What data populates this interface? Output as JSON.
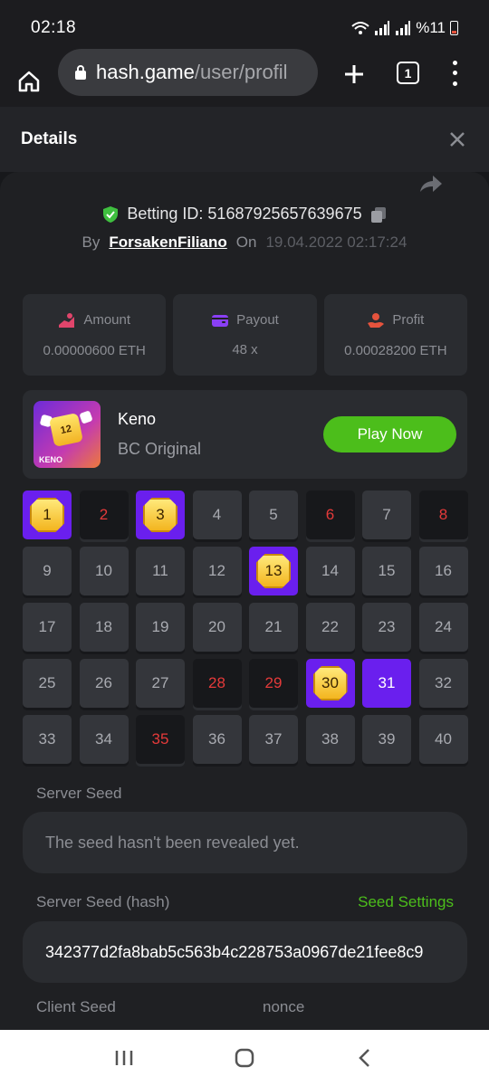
{
  "status_bar": {
    "time": "02:18",
    "battery_text": "%11"
  },
  "browser": {
    "url_host": "hash.game",
    "url_path": "/user/profil",
    "tab_count": "1"
  },
  "details": {
    "title": "Details"
  },
  "bet": {
    "betting_id_label": "Betting ID: 516879256576396​75",
    "by_label": "By",
    "username": "ForsakenFiliano",
    "on_label": "On",
    "date": "19.04.2022 02:17:24"
  },
  "stats": [
    {
      "label": "Amount",
      "value": "0.00000600 ETH",
      "icon": "amount-icon",
      "color": "#e0456b"
    },
    {
      "label": "Payout",
      "value": "48 x",
      "icon": "wallet-icon",
      "color": "#8a3ff5"
    },
    {
      "label": "Profit",
      "value": "0.00028200 ETH",
      "icon": "profit-icon",
      "color": "#e5533d"
    }
  ],
  "game": {
    "name": "Keno",
    "subtitle": "BC Original",
    "play_label": "Play Now",
    "thumb_label": "KENO",
    "thumb_number": "12"
  },
  "keno_tiles": [
    {
      "n": "1",
      "s": "hit"
    },
    {
      "n": "2",
      "s": "dark"
    },
    {
      "n": "3",
      "s": "hit"
    },
    {
      "n": "4",
      "s": "normal"
    },
    {
      "n": "5",
      "s": "normal"
    },
    {
      "n": "6",
      "s": "dark"
    },
    {
      "n": "7",
      "s": "normal"
    },
    {
      "n": "8",
      "s": "dark"
    },
    {
      "n": "9",
      "s": "normal"
    },
    {
      "n": "10",
      "s": "normal"
    },
    {
      "n": "11",
      "s": "normal"
    },
    {
      "n": "12",
      "s": "normal"
    },
    {
      "n": "13",
      "s": "hit"
    },
    {
      "n": "14",
      "s": "normal"
    },
    {
      "n": "15",
      "s": "normal"
    },
    {
      "n": "16",
      "s": "normal"
    },
    {
      "n": "17",
      "s": "normal"
    },
    {
      "n": "18",
      "s": "normal"
    },
    {
      "n": "19",
      "s": "normal"
    },
    {
      "n": "20",
      "s": "normal"
    },
    {
      "n": "21",
      "s": "normal"
    },
    {
      "n": "22",
      "s": "normal"
    },
    {
      "n": "23",
      "s": "normal"
    },
    {
      "n": "24",
      "s": "normal"
    },
    {
      "n": "25",
      "s": "normal"
    },
    {
      "n": "26",
      "s": "normal"
    },
    {
      "n": "27",
      "s": "normal"
    },
    {
      "n": "28",
      "s": "dark"
    },
    {
      "n": "29",
      "s": "dark"
    },
    {
      "n": "30",
      "s": "hit"
    },
    {
      "n": "31",
      "s": "purple"
    },
    {
      "n": "32",
      "s": "normal"
    },
    {
      "n": "33",
      "s": "normal"
    },
    {
      "n": "34",
      "s": "normal"
    },
    {
      "n": "35",
      "s": "dark"
    },
    {
      "n": "36",
      "s": "normal"
    },
    {
      "n": "37",
      "s": "normal"
    },
    {
      "n": "38",
      "s": "normal"
    },
    {
      "n": "39",
      "s": "normal"
    },
    {
      "n": "40",
      "s": "normal"
    }
  ],
  "server_seed": {
    "label": "Server Seed",
    "value": "The seed hasn't been revealed yet."
  },
  "server_seed_hash": {
    "label": "Server Seed (hash)",
    "link": "Seed Settings",
    "value": "342377d2fa8bab5c563b4c228753a0967de21fee8c9"
  },
  "client_seed": {
    "label": "Client Seed"
  },
  "nonce": {
    "label": "nonce"
  },
  "colors": {
    "accent_green": "#4cbe1b",
    "accent_purple": "#6a1fee",
    "loss_red": "#e53a3a"
  }
}
